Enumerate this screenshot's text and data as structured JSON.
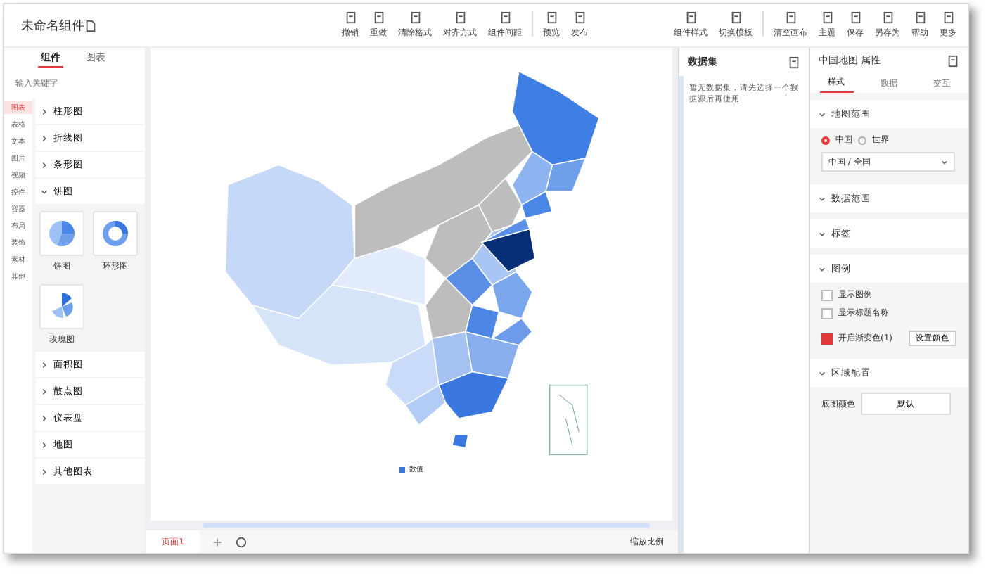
{
  "app": {
    "title": "未命名组件"
  },
  "toolbar": [
    {
      "label": "撤销"
    },
    {
      "label": "重做"
    },
    {
      "label": "清除格式"
    },
    {
      "label": "对齐方式"
    },
    {
      "label": "组件间距"
    },
    {
      "label": "预览"
    },
    {
      "label": "发布"
    }
  ],
  "toolbar_right": [
    {
      "label": "组件样式"
    },
    {
      "label": "切换模板"
    },
    {
      "label": "清空画布"
    },
    {
      "label": "主题"
    },
    {
      "label": "保存"
    },
    {
      "label": "另存为"
    },
    {
      "label": "帮助"
    },
    {
      "label": "更多"
    }
  ],
  "left_tabs": [
    {
      "label": "组件",
      "selected": true
    },
    {
      "label": "图表",
      "selected": false
    }
  ],
  "search": {
    "placeholder": "输入关键字"
  },
  "categories": [
    {
      "label": "图表",
      "selected": true
    },
    {
      "label": "表格",
      "selected": false
    },
    {
      "label": "文本",
      "selected": false
    },
    {
      "label": "图片",
      "selected": false
    },
    {
      "label": "视频",
      "selected": false
    },
    {
      "label": "控件",
      "selected": false
    },
    {
      "label": "容器",
      "selected": false
    },
    {
      "label": "布局",
      "selected": false
    },
    {
      "label": "装饰",
      "selected": false
    },
    {
      "label": "素材",
      "selected": false
    },
    {
      "label": "其他",
      "selected": false
    }
  ],
  "chart_groups": [
    {
      "label": "柱形图",
      "expanded": false
    },
    {
      "label": "折线图",
      "expanded": false
    },
    {
      "label": "条形图",
      "expanded": false
    },
    {
      "label": "饼图",
      "expanded": true,
      "items": [
        {
          "label": "饼图",
          "kind": "pie"
        },
        {
          "label": "环形图",
          "kind": "donut"
        },
        {
          "label": "玫瑰图",
          "kind": "rose"
        }
      ]
    },
    {
      "label": "面积图",
      "expanded": false
    },
    {
      "label": "散点图",
      "expanded": false
    },
    {
      "label": "仪表盘",
      "expanded": false
    },
    {
      "label": "地图",
      "expanded": false
    },
    {
      "label": "其他图表",
      "expanded": false
    }
  ],
  "canvas": {
    "legend": "数值",
    "page_tabs": [
      {
        "label": "页面1",
        "selected": true
      }
    ],
    "zoom": "缩放比例"
  },
  "dataset_panel": {
    "title": "数据集",
    "message": "暂无数据集，请先选择一个数据源后再使用"
  },
  "props_panel": {
    "title": "中国地图 属性",
    "tabs": [
      {
        "label": "样式",
        "selected": true
      },
      {
        "label": "数据",
        "selected": false
      },
      {
        "label": "交互",
        "selected": false
      }
    ],
    "sections": [
      {
        "title": "地图范围",
        "radios": [
          {
            "label": "中国",
            "selected": true
          },
          {
            "label": "世界",
            "selected": false
          }
        ],
        "select": "中国 / 全国"
      },
      {
        "title": "数据范围"
      },
      {
        "title": "标签"
      },
      {
        "title": "图例",
        "checkboxes": [
          {
            "label": "显示图例",
            "checked": false
          },
          {
            "label": "显示标题名称",
            "checked": false
          }
        ]
      },
      {
        "title": "开启渐变色(1)",
        "checked": true,
        "button": "设置颜色",
        "kind": "toggle"
      },
      {
        "title": "区域配置",
        "field_label": "底图颜色",
        "field_value": "默认"
      }
    ]
  }
}
